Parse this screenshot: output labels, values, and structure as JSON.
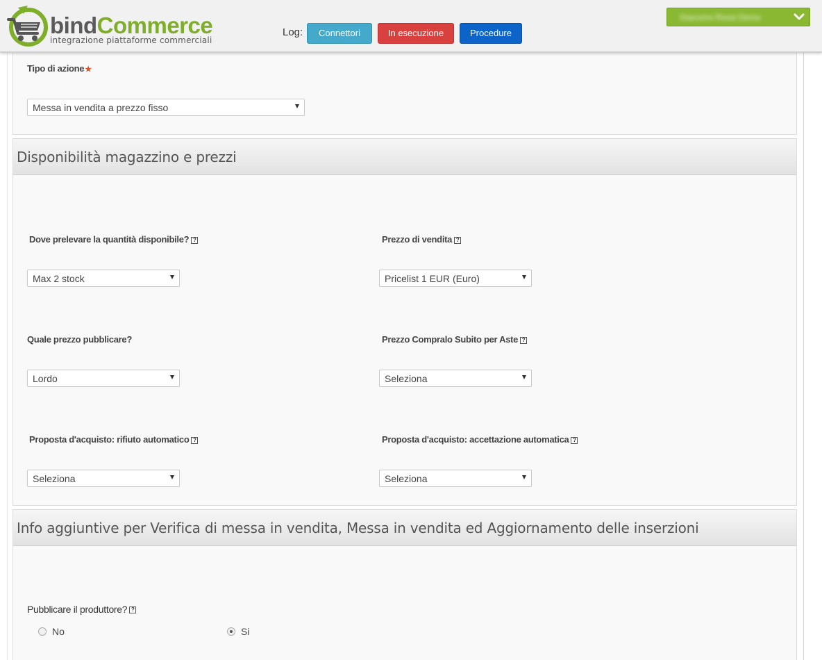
{
  "header": {
    "logo": {
      "name_part1": "bind",
      "name_part2": "Commerce",
      "tagline": "integrazione piattaforme commerciali"
    },
    "log_label": "Log:",
    "buttons": [
      {
        "label": "Connettori",
        "color": "#44a9cb"
      },
      {
        "label": "In esecuzione",
        "color": "#d9413f"
      },
      {
        "label": "Procedure",
        "color": "#0c64c8"
      }
    ],
    "user_menu": {
      "name": "Giacomo Rossi Demo",
      "icon": "chevron-down-icon",
      "color": "#8ab832"
    }
  },
  "action_type": {
    "label": "Tipo di azione",
    "required_mark": "★",
    "value": "Messa in vendita a prezzo fisso"
  },
  "stock_section": {
    "title": "Disponibilità magazzino e prezzi",
    "fields": {
      "quantity_source": {
        "label": "Dove prelevare la quantità disponibile?",
        "value": "Max 2 stock"
      },
      "sale_price": {
        "label": "Prezzo di vendita",
        "value": "Pricelist 1 EUR (Euro)"
      },
      "price_to_publish": {
        "label": "Quale prezzo pubblicare?",
        "value": "Lordo"
      },
      "buy_now_price": {
        "label": "Prezzo Compralo Subito per Aste",
        "value": "Seleziona"
      },
      "auto_decline": {
        "label": "Proposta d'acquisto: rifiuto automatico",
        "value": "Seleziona"
      },
      "auto_accept": {
        "label": "Proposta d'acquisto: accettazione automatica",
        "value": "Seleziona"
      }
    },
    "help_glyph": "?"
  },
  "info_section": {
    "title": "Info aggiuntive per Verifica di messa in vendita, Messa in vendita ed Aggiornamento delle inserzioni",
    "publish_manufacturer": {
      "label": "Pubblicare il produttore?",
      "options": [
        {
          "label": "No",
          "selected": false
        },
        {
          "label": "Si",
          "selected": true
        }
      ]
    }
  }
}
